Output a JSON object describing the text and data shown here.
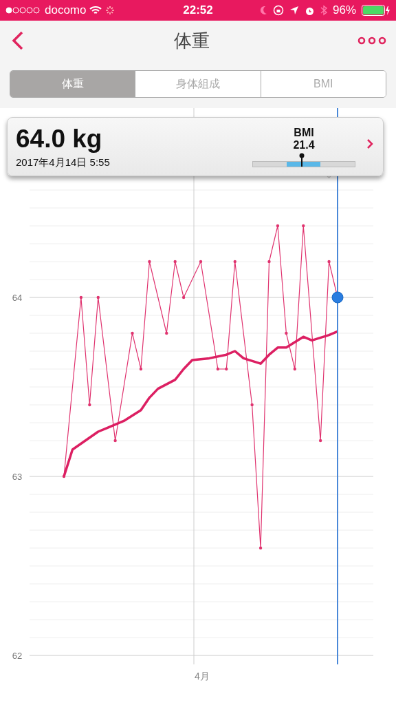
{
  "status_bar": {
    "carrier": "docomo",
    "time": "22:52",
    "battery_text": "96%"
  },
  "nav": {
    "title": "体重"
  },
  "tabs": [
    {
      "label": "体重",
      "selected": true
    },
    {
      "label": "身体組成",
      "selected": false
    },
    {
      "label": "BMI",
      "selected": false
    }
  ],
  "reading": {
    "weight": "64.0 kg",
    "date": "2017年4月14日 5:55",
    "bmi_label": "BMI",
    "bmi_value": "21.4",
    "level": 0.48
  },
  "chart": {
    "month_label": "4月",
    "chart_data": {
      "type": "line",
      "categories": [
        null,
        null,
        null,
        null,
        null,
        null,
        null,
        null,
        null,
        null,
        null,
        null,
        null,
        null,
        null,
        null,
        null,
        null,
        null,
        null,
        null,
        null,
        null,
        null,
        null,
        null,
        null,
        null,
        null,
        null,
        null,
        null,
        null
      ],
      "yticks": [
        {
          "value": 62,
          "label": "62"
        },
        {
          "value": 63,
          "label": "63"
        },
        {
          "value": 64,
          "label": "64"
        }
      ],
      "grid": true,
      "ylim": [
        62,
        64.6
      ],
      "series": [
        {
          "color": "#e0336f",
          "values": [
            63.0,
            null,
            64.0,
            63.4,
            64.0,
            null,
            63.2,
            null,
            63.8,
            63.6,
            64.2,
            null,
            63.8,
            64.2,
            64.0,
            null,
            64.2,
            null,
            63.6,
            63.6,
            64.2,
            null,
            63.4,
            62.6,
            64.2,
            64.4,
            63.8,
            63.6,
            64.4,
            null,
            63.2,
            64.2,
            64.0
          ]
        },
        {
          "color": "#dc1f62",
          "values": [
            63.0,
            63.15,
            null,
            null,
            63.25,
            63.27,
            null,
            63.31,
            null,
            63.37,
            63.44,
            63.49,
            null,
            63.54,
            63.6,
            63.65,
            null,
            63.66,
            null,
            63.68,
            63.7,
            63.66,
            null,
            63.63,
            63.68,
            63.72,
            63.72,
            63.75,
            63.78,
            63.76,
            null,
            63.79,
            63.81
          ]
        }
      ]
    }
  }
}
